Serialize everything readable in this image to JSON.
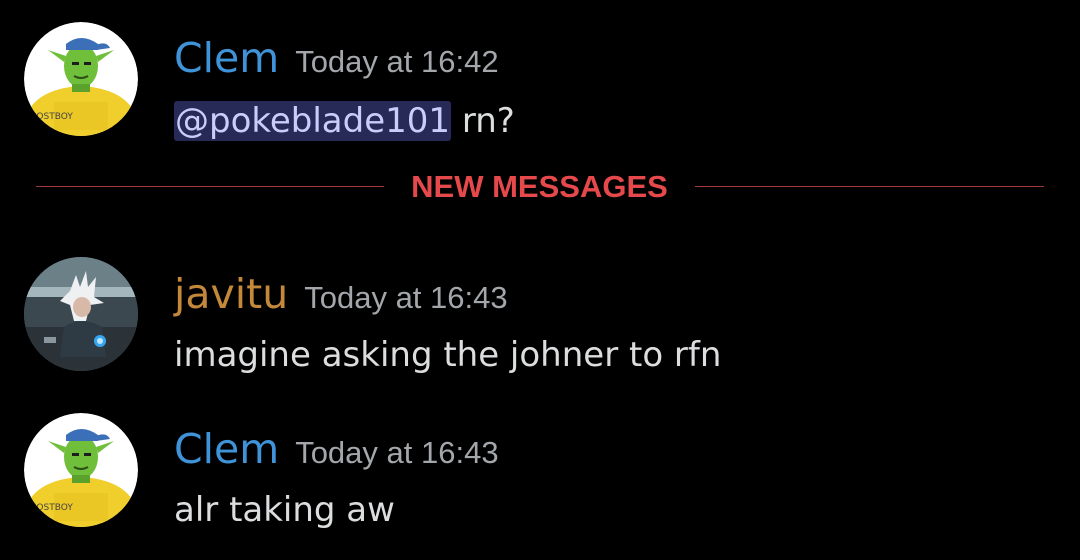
{
  "colors": {
    "background": "#000000",
    "user_clem": "#3f93d8",
    "user_javitu": "#c3883a",
    "timestamp": "#a3a6aa",
    "message_text": "#dcddde",
    "mention_bg": "#272a57",
    "mention_text": "#c9cdfb",
    "new_messages_red": "#e5494c"
  },
  "divider": {
    "label": "NEW MESSAGES"
  },
  "messages": [
    {
      "author": "Clem",
      "timestamp": "Today at 16:42",
      "mention": "@pokeblade101",
      "text": " rn?",
      "avatar": "piccolo-avatar",
      "avatar_text": "POSTBOY"
    },
    {
      "author": "javitu",
      "timestamp": "Today at 16:43",
      "text": "imagine asking the johner to rfn",
      "avatar": "anime-character-avatar"
    },
    {
      "author": "Clem",
      "timestamp": "Today at 16:43",
      "text": "alr taking aw",
      "avatar": "piccolo-avatar",
      "avatar_text": "POSTBOY"
    }
  ]
}
